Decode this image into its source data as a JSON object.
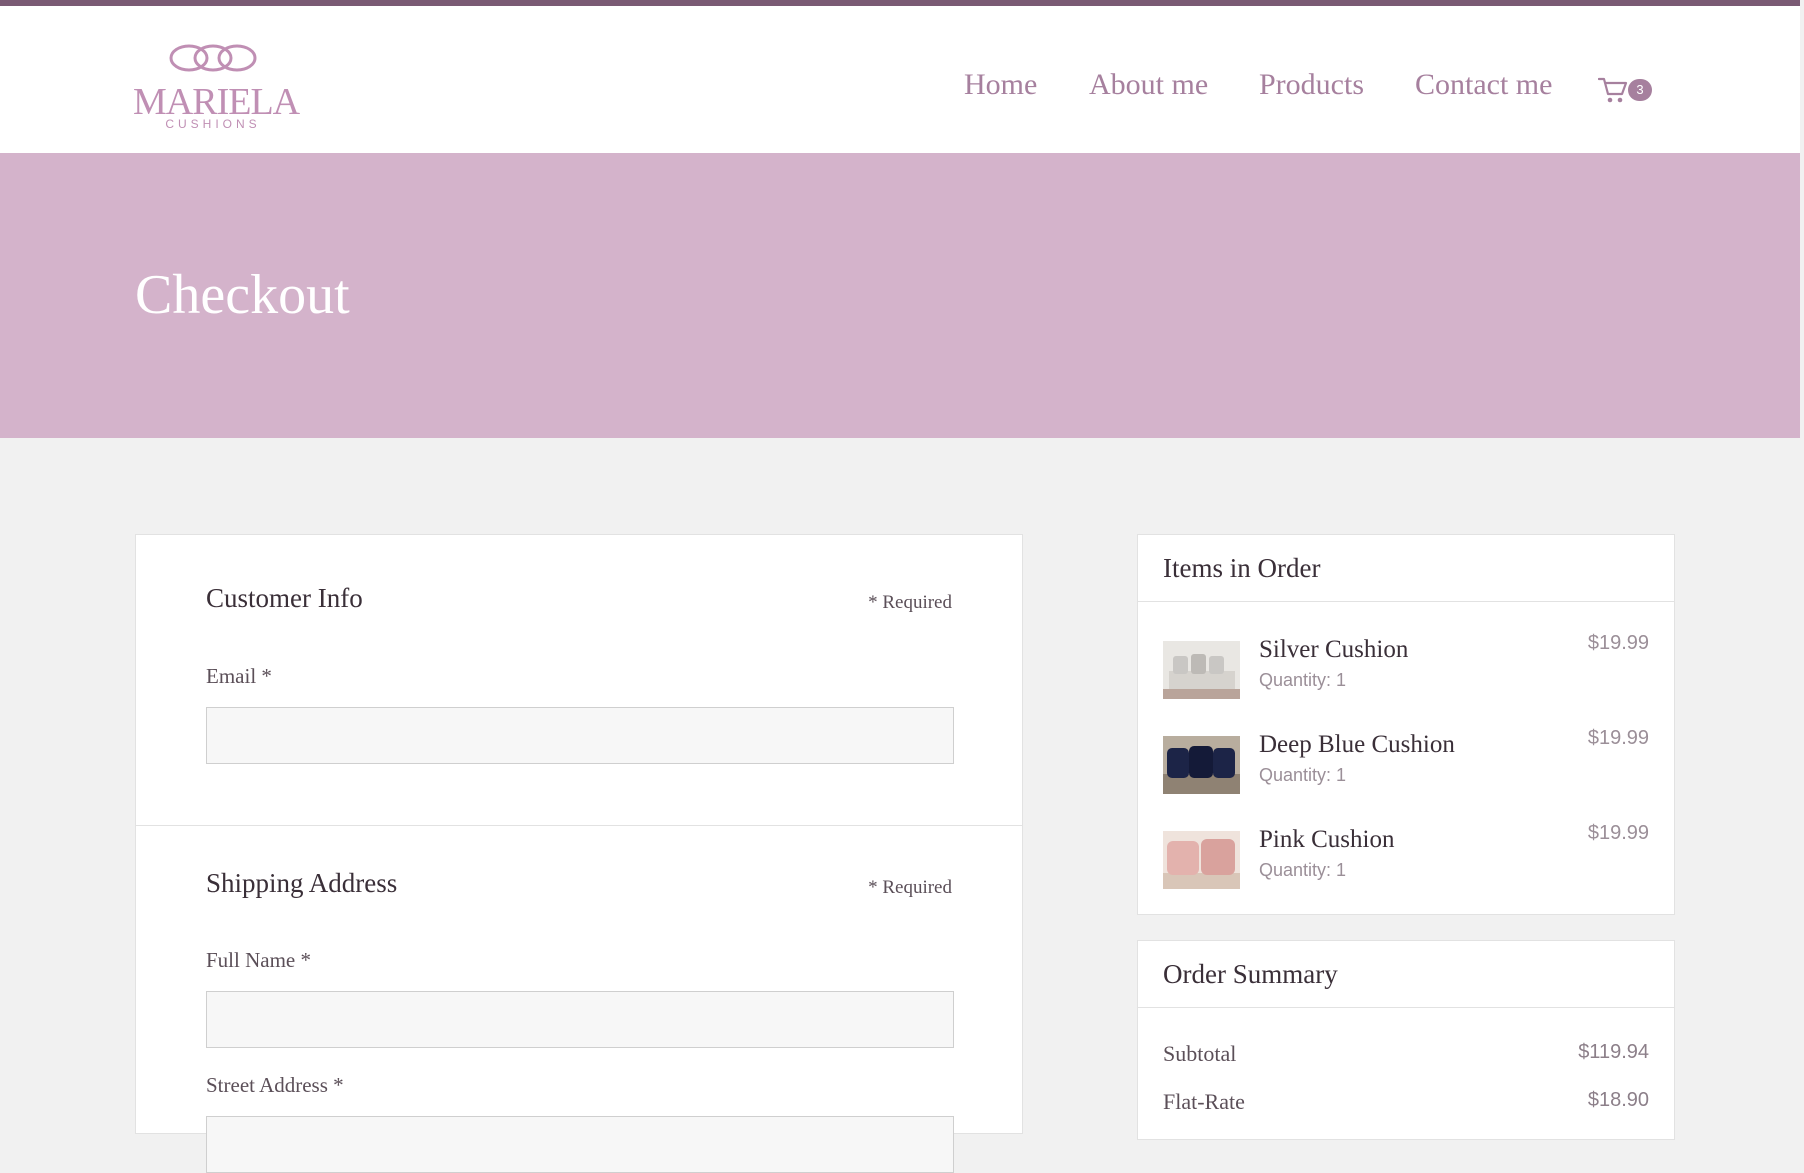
{
  "colors": {
    "brand": "#a6809e",
    "hero_background": "#d4b3cb",
    "page_background": "#f1f1f1"
  },
  "logo": {
    "name": "MARIELA",
    "tagline": "CUSHIONS"
  },
  "nav": {
    "items": [
      {
        "label": "Home"
      },
      {
        "label": "About me"
      },
      {
        "label": "Products"
      },
      {
        "label": "Contact me"
      }
    ],
    "cart": {
      "icon": "cart-icon",
      "count": "3"
    }
  },
  "hero": {
    "title": "Checkout"
  },
  "customer_info": {
    "title": "Customer Info",
    "required_note": "* Required",
    "email": {
      "label": "Email *",
      "value": "",
      "placeholder": ""
    }
  },
  "shipping_address": {
    "title": "Shipping Address",
    "required_note": "* Required",
    "full_name": {
      "label": "Full Name *",
      "value": "",
      "placeholder": ""
    },
    "street_address": {
      "label": "Street Address *",
      "value": "",
      "placeholder": ""
    }
  },
  "items_in_order": {
    "title": "Items in Order",
    "items": [
      {
        "name": "Silver Cushion",
        "quantity": "Quantity: 1",
        "price": "$19.99",
        "color": "#c9c7c4"
      },
      {
        "name": "Deep Blue Cushion",
        "quantity": "Quantity: 1",
        "price": "$19.99",
        "color": "#1c2447"
      },
      {
        "name": "Pink Cushion",
        "quantity": "Quantity: 1",
        "price": "$19.99",
        "color": "#e3b2ad"
      }
    ]
  },
  "order_summary": {
    "title": "Order Summary",
    "rows": [
      {
        "label": "Subtotal",
        "value": "$119.94"
      },
      {
        "label": "Flat-Rate",
        "value": "$18.90"
      }
    ]
  }
}
